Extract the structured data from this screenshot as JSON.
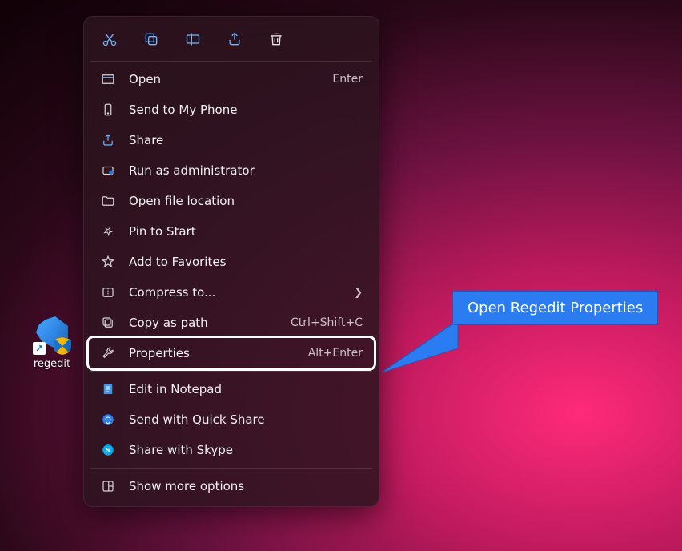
{
  "desktop": {
    "icon_label": "regedit"
  },
  "iconbar": {
    "cut": "cut-icon",
    "copy": "copy-icon",
    "rename": "rename-icon",
    "share": "share-icon",
    "delete": "delete-icon"
  },
  "menu": {
    "open": {
      "label": "Open",
      "shortcut": "Enter"
    },
    "sendphone": {
      "label": "Send to My Phone"
    },
    "share": {
      "label": "Share"
    },
    "runadmin": {
      "label": "Run as administrator"
    },
    "openloc": {
      "label": "Open file location"
    },
    "pinstart": {
      "label": "Pin to Start"
    },
    "addfav": {
      "label": "Add to Favorites"
    },
    "compress": {
      "label": "Compress to..."
    },
    "copypath": {
      "label": "Copy as path",
      "shortcut": "Ctrl+Shift+C"
    },
    "properties": {
      "label": "Properties",
      "shortcut": "Alt+Enter"
    },
    "editnotepad": {
      "label": "Edit in Notepad"
    },
    "quickshare": {
      "label": "Send with Quick Share"
    },
    "skype": {
      "label": "Share with Skype"
    },
    "more": {
      "label": "Show more options"
    }
  },
  "callout": {
    "text": "Open Regedit Properties"
  }
}
